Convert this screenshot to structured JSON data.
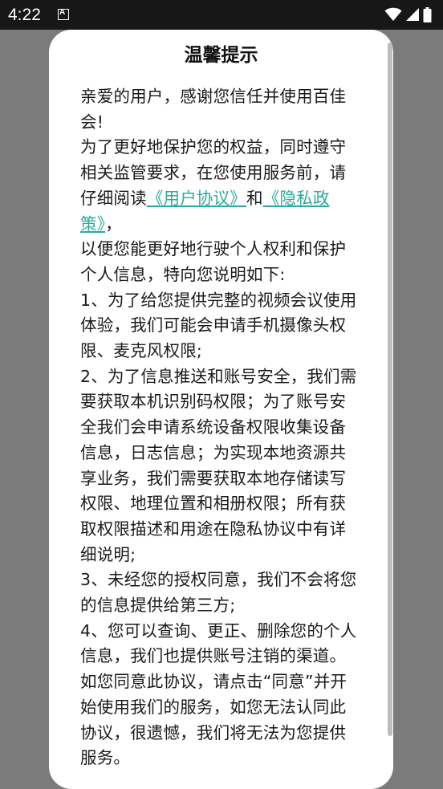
{
  "status_bar": {
    "time": "4:22",
    "icons": [
      "notification-a-icon",
      "wifi-icon",
      "signal-icon",
      "battery-icon"
    ]
  },
  "dialog": {
    "title": "温馨提示",
    "paragraphs": {
      "p1": "亲爱的用户，感谢您信任并使用百佳会!",
      "p2_before": "为了更好地保护您的权益，同时遵守相关监管要求，在您使用服务前，请仔细阅读",
      "link_user_agreement": "《用户协议》",
      "p2_and": "和",
      "link_privacy_policy": "《隐私政策》",
      "p2_after": "，",
      "p3": "以便您能更好地行驶个人权利和保护个人信息，特向您说明如下:",
      "p4": "1、为了给您提供完整的视频会议使用体验，我们可能会申请手机摄像头权限、麦克风权限;",
      "p5": "2、为了信息推送和账号安全，我们需要获取本机识别码权限；为了账号安全我们会申请系统设备权限收集设备信息，日志信息；为实现本地资源共享业务，我们需要获取本地存储读写权限、地理位置和相册权限；所有获取权限描述和用途在隐私协议中有详细说明;",
      "p6": "3、未经您的授权同意，我们不会将您的信息提供给第三方;",
      "p7": "4、您可以查询、更正、删除您的个人信息，我们也提供账号注销的渠道。",
      "p8": "如您同意此协议，请点击“同意”并开始使用我们的服务，如您无法认同此协议，很遗憾，我们将无法为您提供服务。"
    }
  },
  "colors": {
    "link": "#2bab9c",
    "overlay": "#7b7b7b",
    "status_bar": "#171717"
  }
}
